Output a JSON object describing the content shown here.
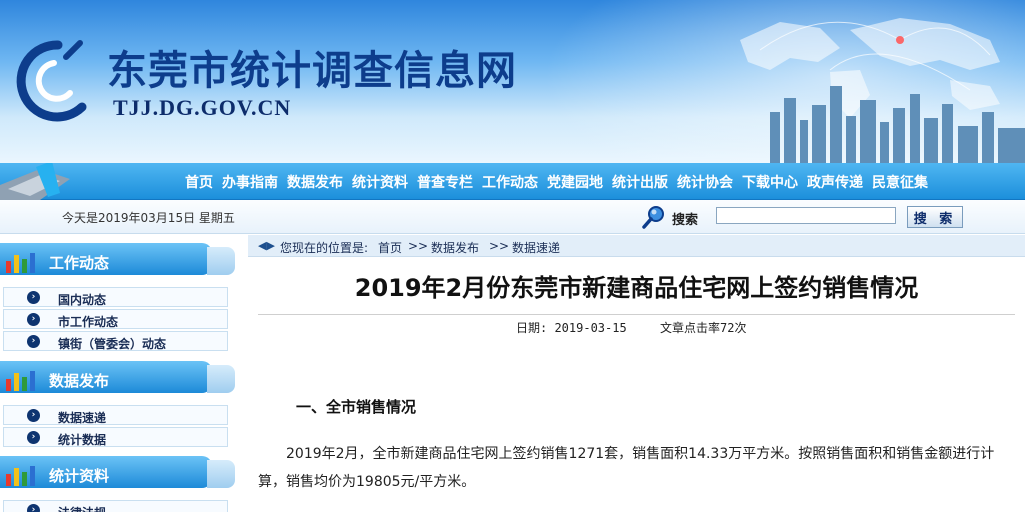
{
  "banner": {
    "site_title": "东莞市统计调查信息网",
    "site_url": "TJJ.DG.GOV.CN"
  },
  "nav": {
    "items": [
      "首页",
      "办事指南",
      "数据发布",
      "统计资料",
      "普查专栏",
      "工作动态",
      "党建园地",
      "统计出版",
      "统计协会",
      "下载中心",
      "政声传递",
      "民意征集"
    ]
  },
  "infobar": {
    "date_text": "今天是2019年03月15日  星期五",
    "search_label": "搜索",
    "search_value": "",
    "search_button": "搜 索"
  },
  "sidebar": {
    "sections": [
      {
        "title": "工作动态",
        "items": [
          "国内动态",
          "市工作动态",
          "镇街（管委会）动态"
        ]
      },
      {
        "title": "数据发布",
        "items": [
          "数据速递",
          "统计数据"
        ]
      },
      {
        "title": "统计资料",
        "items": [
          "法律法规"
        ]
      }
    ]
  },
  "breadcrumb": {
    "prefix": "您现在的位置是:",
    "items": [
      "首页",
      "数据发布",
      "数据速递"
    ],
    "separator": ">>"
  },
  "article": {
    "title": "2019年2月份东莞市新建商品住宅网上签约销售情况",
    "date_label": "日期: 2019-03-15",
    "clicks_label": "文章点击率72次",
    "section1_heading": "一、全市销售情况",
    "paragraph1": "2019年2月，全市新建商品住宅网上签约销售1271套，销售面积14.33万平方米。按照销售面积和销售金额进行计算，销售均价为19805元/平方米。"
  },
  "colors": {
    "nav_bg": "#1c8fdb",
    "title_blue": "#0d3d8c",
    "sidebar_head": "#1d8ad8",
    "bullet": "#0e3470"
  },
  "icons": {
    "logo": "dongguan-stats-logo",
    "search": "magnifier-icon",
    "bullet": "chevron-right-circle-icon",
    "section": "bar-chart-icon"
  }
}
